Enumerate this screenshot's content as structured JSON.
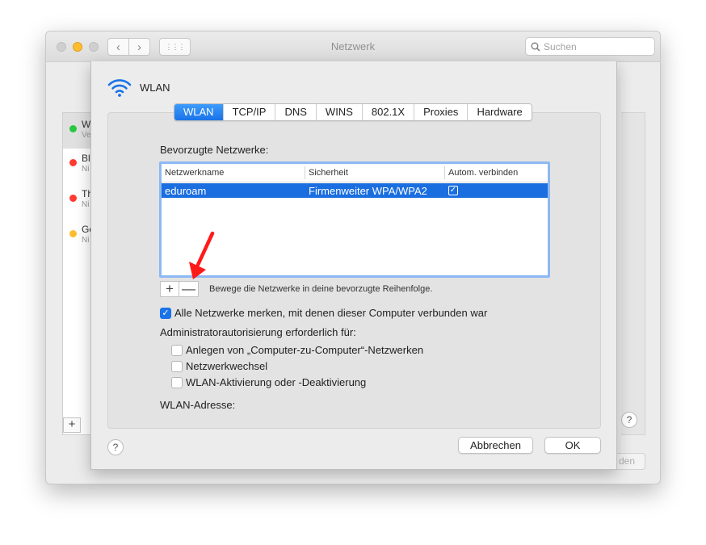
{
  "window": {
    "title": "Netzwerk",
    "search_placeholder": "Suchen",
    "back_icon": "‹",
    "forward_icon": "›",
    "grid_icon": "⋮⋮⋮"
  },
  "background": {
    "sidebar_items": [
      {
        "name": "W",
        "sub": "Ve",
        "status_color": "#28c840"
      },
      {
        "name": "Bl",
        "sub": "Ni",
        "status_color": "#ff3b30"
      },
      {
        "name": "Th",
        "sub": "Ni",
        "status_color": "#ff3b30"
      },
      {
        "name": "Ge",
        "sub": "Ni",
        "status_color": "#ffbd2e"
      }
    ],
    "plus": "+",
    "help": "?",
    "button_fragment": "den"
  },
  "sheet": {
    "title": "WLAN",
    "tabs": [
      {
        "label": "WLAN",
        "active": true
      },
      {
        "label": "TCP/IP",
        "active": false
      },
      {
        "label": "DNS",
        "active": false
      },
      {
        "label": "WINS",
        "active": false
      },
      {
        "label": "802.1X",
        "active": false
      },
      {
        "label": "Proxies",
        "active": false
      },
      {
        "label": "Hardware",
        "active": false
      }
    ],
    "preferred_label": "Bevorzugte Netzwerke:",
    "table": {
      "columns": [
        "Netzwerkname",
        "Sicherheit",
        "Autom. verbinden"
      ],
      "rows": [
        {
          "name": "eduroam",
          "security": "Firmenweiter WPA/WPA2",
          "auto_connect": true,
          "selected": true
        }
      ]
    },
    "add_button": "+",
    "remove_button": "—",
    "reorder_hint": "Bewege die Netzwerke in deine bevorzugte Reihenfolge.",
    "remember_networks": {
      "label": "Alle Netzwerke merken, mit denen dieser Computer verbunden war",
      "checked": true
    },
    "admin_label": "Administratorautorisierung erforderlich für:",
    "admin_options": [
      {
        "label": "Anlegen von „Computer-zu-Computer“-Netzwerken",
        "checked": false
      },
      {
        "label": "Netzwerkwechsel",
        "checked": false
      },
      {
        "label": "WLAN-Aktivierung oder -Deaktivierung",
        "checked": false
      }
    ],
    "address_label": "WLAN-Adresse:",
    "help": "?",
    "cancel_label": "Abbrechen",
    "ok_label": "OK",
    "check_glyph": "✓"
  },
  "colors": {
    "accent": "#1a73e8",
    "annotation_arrow": "#ff1a1a"
  }
}
